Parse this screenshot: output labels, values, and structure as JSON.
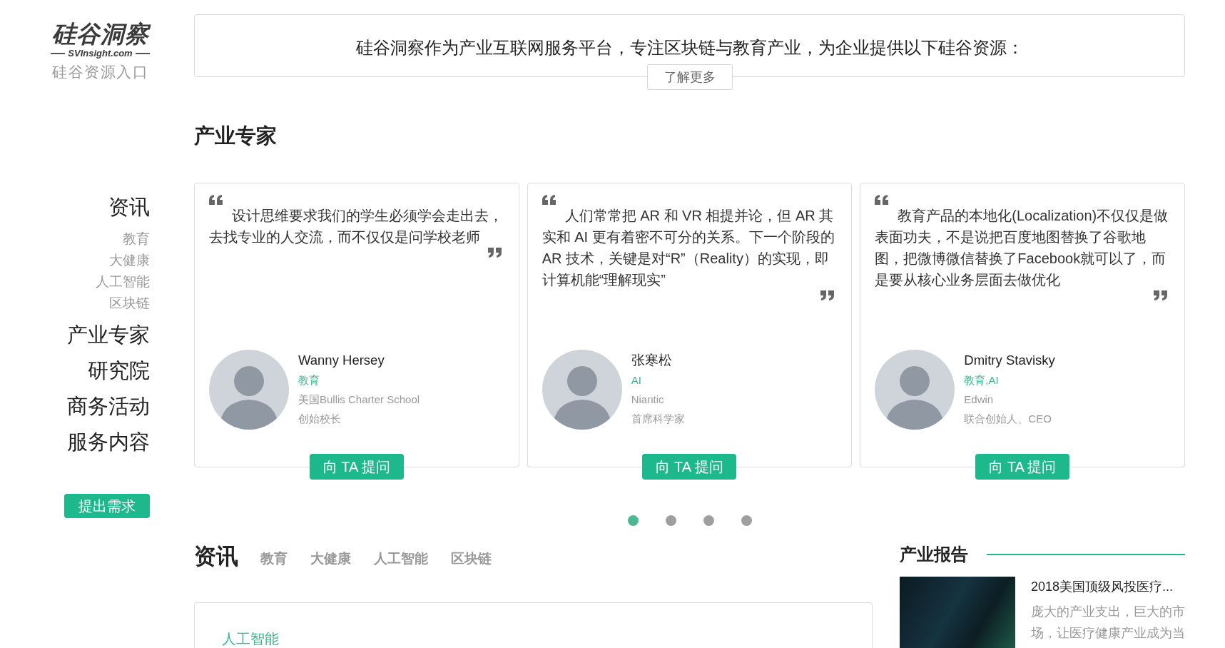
{
  "logo": {
    "title": "硅谷洞察",
    "domain": "SVInsight.com",
    "tagline": "硅谷资源入口"
  },
  "sidebar": {
    "items": [
      {
        "label": "资讯",
        "children": [
          {
            "label": "教育"
          },
          {
            "label": "大健康"
          },
          {
            "label": "人工智能"
          },
          {
            "label": "区块链"
          }
        ]
      },
      {
        "label": "产业专家"
      },
      {
        "label": "研究院"
      },
      {
        "label": "商务活动"
      },
      {
        "label": "服务内容"
      }
    ],
    "button": "提出需求"
  },
  "banner": {
    "text": "硅谷洞察作为产业互联网服务平台，专注区块链与教育产业，为企业提供以下硅谷资源：",
    "button": "了解更多"
  },
  "experts": {
    "title": "产业专家",
    "cards": [
      {
        "quote": "设计思维要求我们的学生必须学会走出去，去找专业的人交流，而不仅仅是问学校老师",
        "name": "Wanny Hersey",
        "tags": "教育",
        "company": "美国Bullis Charter School",
        "role": "创始校长",
        "button": "向 TA 提问"
      },
      {
        "quote": "人们常常把 AR 和 VR 相提并论，但 AR 其实和 AI 更有着密不可分的关系。下一个阶段的 AR 技术，关键是对“R”（Reality）的实现，即计算机能“理解现实”",
        "name": "张寒松",
        "tags": "AI",
        "company": "Niantic",
        "role": "首席科学家",
        "button": "向 TA 提问"
      },
      {
        "quote": "教育产品的本地化(Localization)不仅仅是做表面功夫，不是说把百度地图替换了谷歌地图，把微博微信替换了Facebook就可以了，而是要从核心业务层面去做优化",
        "name": "Dmitry Stavisky",
        "tags": "教育,AI",
        "company": "Edwin",
        "role": "联合创始人、CEO",
        "button": "向 TA 提问"
      }
    ],
    "pager": [
      {
        "selected": true
      },
      {
        "selected": false
      },
      {
        "selected": false
      },
      {
        "selected": false
      }
    ]
  },
  "news": {
    "title": "资讯",
    "tabs": [
      {
        "label": "教育"
      },
      {
        "label": "大健康"
      },
      {
        "label": "人工智能"
      },
      {
        "label": "区块链"
      }
    ],
    "card": {
      "category": "人工智能"
    }
  },
  "reports": {
    "title": "产业报告",
    "items": [
      {
        "title": "2018美国顶级风投医疗...",
        "summary": "庞大的产业支出，巨大的市场，让医疗健康产业成为当"
      }
    ]
  }
}
